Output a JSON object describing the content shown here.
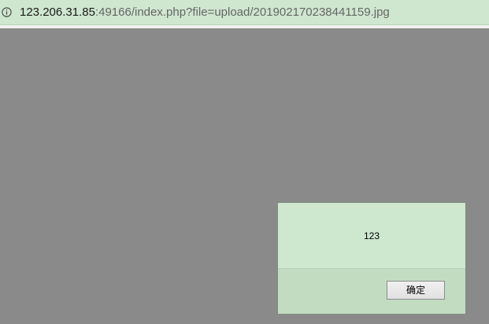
{
  "address_bar": {
    "icon": "info-icon",
    "url_host": "123.206.31.85",
    "url_rest": ":49166/index.php?file=upload/201902170238441159.jpg"
  },
  "alert": {
    "message": "123",
    "ok_label": "确定"
  },
  "colors": {
    "address_bar_bg": "#cfe6cf",
    "page_bg": "#8a8a8a",
    "dialog_body_bg": "#cde8cf",
    "dialog_footer_bg": "#c2dcc2"
  }
}
